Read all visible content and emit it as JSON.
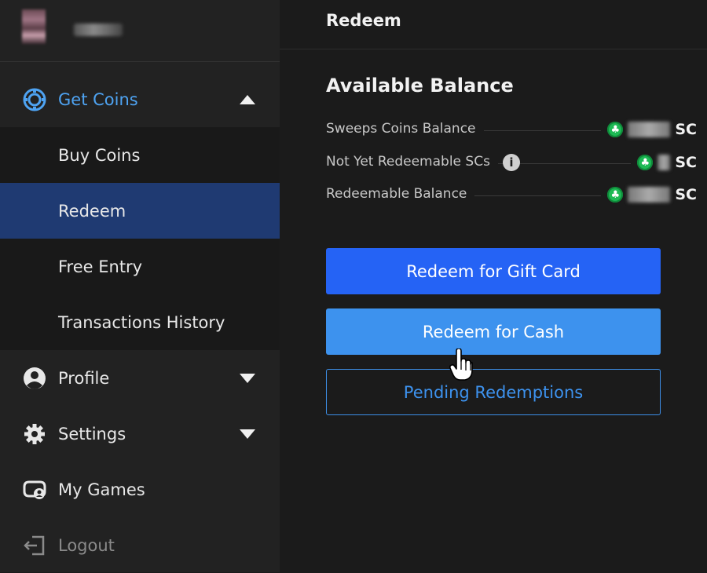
{
  "sidebar": {
    "user": {
      "avatar": "user-avatar",
      "name_hidden": true
    },
    "items": [
      {
        "label": "Get Coins",
        "icon": "coins-icon",
        "expanded": true
      },
      {
        "label": "Buy Coins"
      },
      {
        "label": "Redeem",
        "active": true
      },
      {
        "label": "Free Entry"
      },
      {
        "label": "Transactions History"
      },
      {
        "label": "Profile",
        "icon": "user-icon"
      },
      {
        "label": "Settings",
        "icon": "gear-icon"
      },
      {
        "label": "My Games",
        "icon": "games-icon"
      },
      {
        "label": "Logout",
        "icon": "logout-icon"
      }
    ]
  },
  "header": {
    "title": "Redeem"
  },
  "balance": {
    "title": "Available Balance",
    "rows": [
      {
        "label": "Sweeps Coins Balance",
        "currency": "SC"
      },
      {
        "label": "Not Yet Redeemable SCs",
        "currency": "SC",
        "info_icon": "i"
      },
      {
        "label": "Redeemable Balance",
        "currency": "SC"
      }
    ]
  },
  "buttons": {
    "gift_card": "Redeem for Gift Card",
    "cash": "Redeem for Cash",
    "pending": "Pending Redemptions"
  },
  "colors": {
    "accent_blue": "#4ea3f2",
    "primary_button": "#2563f5",
    "secondary_button": "#3d92ee",
    "active_nav": "#1f3a72",
    "coin_green": "#1db954"
  }
}
